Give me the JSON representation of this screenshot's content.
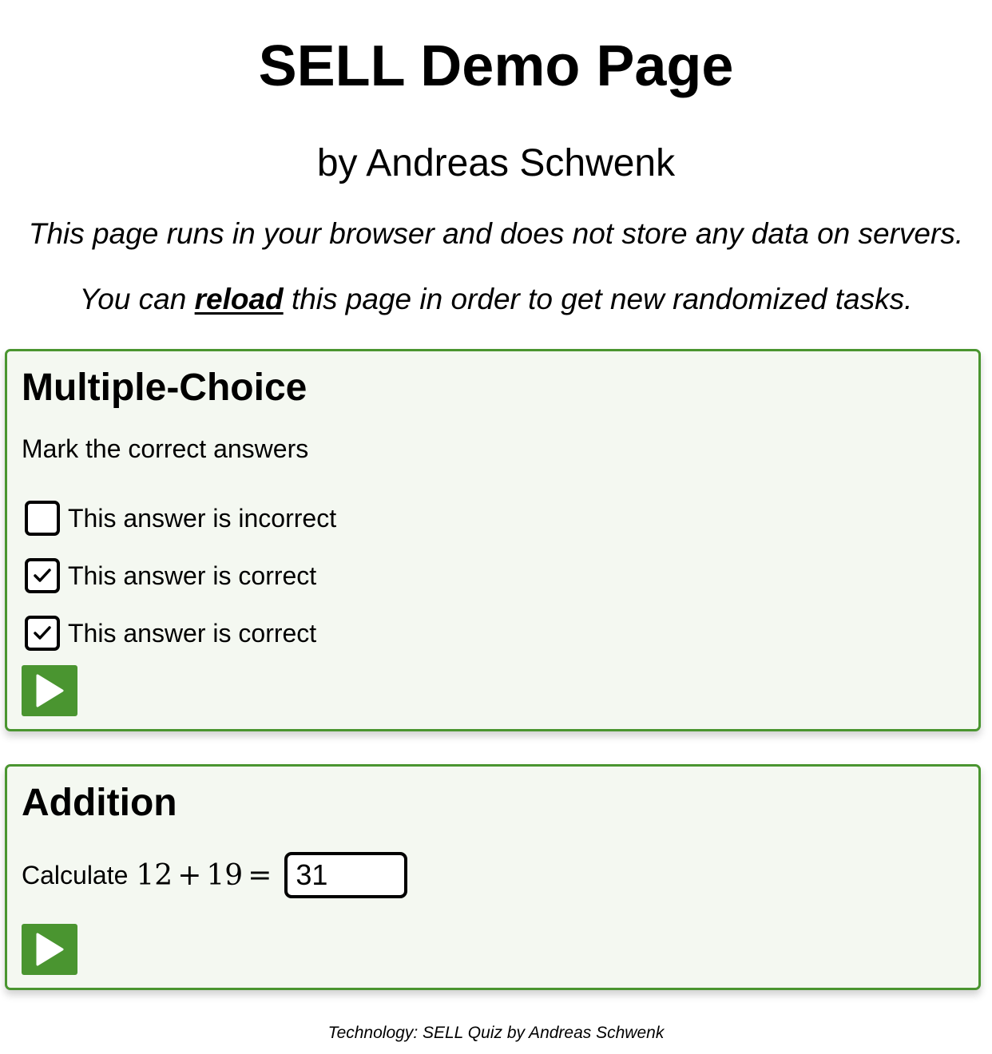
{
  "header": {
    "title": "SELL Demo Page",
    "author": "by Andreas Schwenk",
    "note_storage": "This page runs in your browser and does not store any data on servers.",
    "note_reload_prefix": "You can ",
    "note_reload_link": "reload",
    "note_reload_suffix": " this page in order to get new randomized tasks."
  },
  "multiple_choice": {
    "title": "Multiple-Choice",
    "instruction": "Mark the correct answers",
    "options": [
      {
        "label": "This answer is incorrect",
        "checked": false
      },
      {
        "label": "This answer is correct",
        "checked": true
      },
      {
        "label": "This answer is correct",
        "checked": true
      }
    ],
    "submit_icon": "play-icon"
  },
  "addition": {
    "title": "Addition",
    "prompt": "Calculate",
    "operand_a": "12",
    "operator": "+",
    "operand_b": "19",
    "equals": "=",
    "answer_value": "31",
    "submit_icon": "play-icon"
  },
  "footer": {
    "text": "Technology: SELL Quiz by Andreas Schwenk"
  },
  "colors": {
    "accent_green": "#4a9530",
    "card_background": "#f4f8f1"
  }
}
